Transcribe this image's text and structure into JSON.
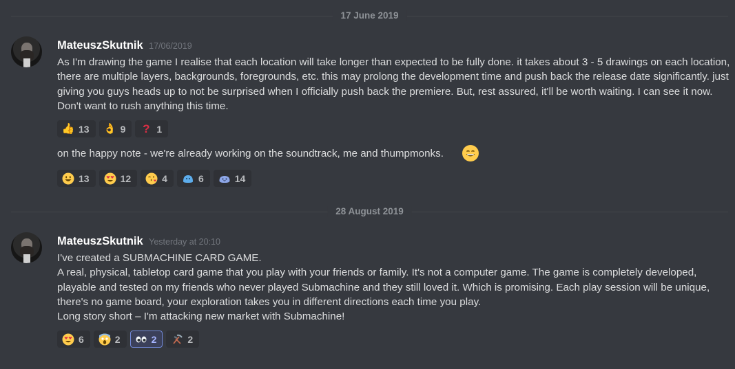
{
  "dividers": [
    "17 June 2019",
    "28 August 2019"
  ],
  "messages": [
    {
      "username": "MateuszSkutnik",
      "timestamp": "17/06/2019",
      "text": "As I'm drawing the game I realise that each location will take longer than expected to be fully done. it takes about 3 - 5 drawings on each location, there are multiple layers, backgrounds, foregrounds, etc. this may prolong the development time and push back the release date significantly. just giving you  guys heads up to not be surprised when I officially push back the premiere. But, rest assured, it'll be worth waiting. I can see it now. Don't want to rush anything this time.",
      "reactions": [
        {
          "emoji": "thumbs-up",
          "count": "13"
        },
        {
          "emoji": "ok-hand",
          "count": "9"
        },
        {
          "emoji": "red-question-mark",
          "count": "1"
        }
      ],
      "followup_text": "on the happy note - we're already working on the soundtrack, me and thumpmonks.",
      "followup_emoji": "grinning-face",
      "followup_reactions": [
        {
          "emoji": "grinning-face",
          "count": "13"
        },
        {
          "emoji": "heart-eyes",
          "count": "12"
        },
        {
          "emoji": "kissing-heart",
          "count": "4"
        },
        {
          "emoji": "blue-blob",
          "count": "6"
        },
        {
          "emoji": "blue-blob-smile",
          "count": "14"
        }
      ]
    },
    {
      "username": "MateuszSkutnik",
      "timestamp": "Yesterday at 20:10",
      "lines": [
        "I've created a SUBMACHINE CARD GAME.",
        "A real, physical, tabletop card game that you play with your friends or family. It's not a computer game. The game is completely developed, playable and tested on my friends who never played Submachine and they still loved it. Which is promising. Each play session will be unique, there's no game board, your exploration takes you in different directions each time you play.",
        "Long story short – I'm attacking new market with Submachine!"
      ],
      "reactions": [
        {
          "emoji": "heart-eyes",
          "count": "6"
        },
        {
          "emoji": "scream",
          "count": "2"
        },
        {
          "emoji": "eyes",
          "count": "2",
          "active": true
        },
        {
          "emoji": "hammer-pick",
          "count": "2"
        }
      ]
    }
  ]
}
